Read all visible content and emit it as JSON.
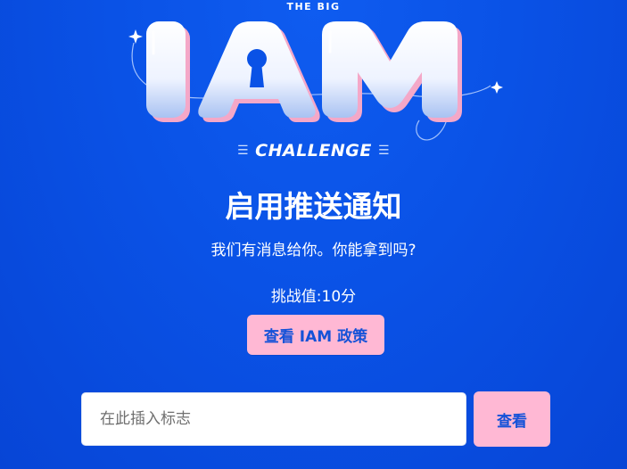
{
  "logo": {
    "top_text": "THE BIG",
    "main_text": "IAM",
    "bottom_text": "CHALLENGE"
  },
  "heading": {
    "title": "启用推送通知",
    "subtitle": "我们有消息给你。你能拿到吗?"
  },
  "score": {
    "text": "挑战值:10分"
  },
  "buttons": {
    "view_policy_label": "查看 IAM 政策",
    "check_label": "查看"
  },
  "flag_input": {
    "placeholder": "在此插入标志",
    "value": ""
  },
  "colors": {
    "background": "#0a52e6",
    "button_bg": "#ffb8d4",
    "button_text": "#1552d8",
    "logo_pink": "#f4a8c8"
  }
}
